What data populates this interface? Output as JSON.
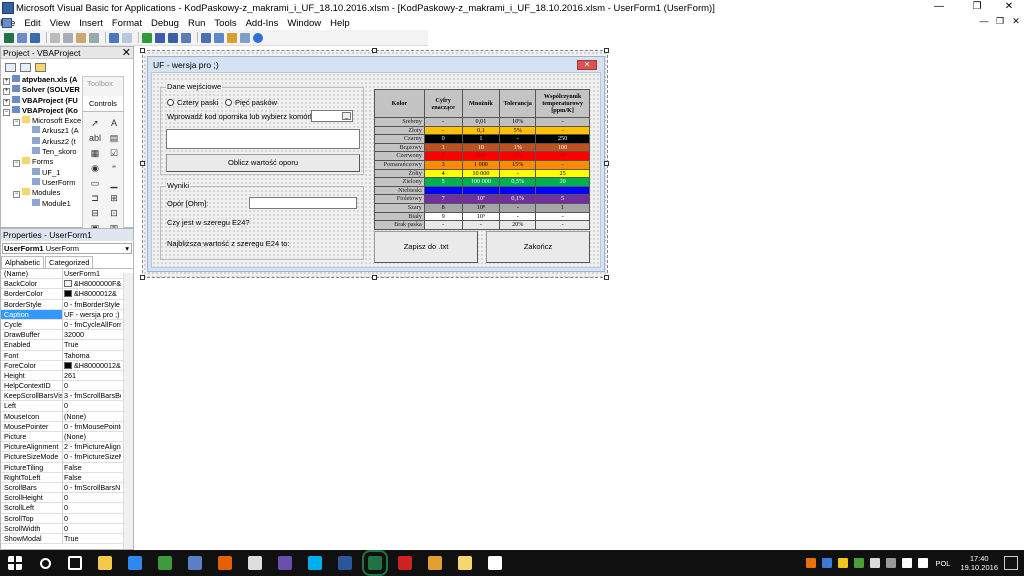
{
  "window": {
    "title": "Microsoft Visual Basic for Applications - KodPaskowy-z_makrami_i_UF_18.10.2016.xlsm - [KodPaskowy-z_makrami_i_UF_18.10.2016.xlsm - UserForm1 (UserForm)]",
    "controls": [
      "—",
      "❐",
      "✕"
    ]
  },
  "menu": {
    "items": [
      "File",
      "Edit",
      "View",
      "Insert",
      "Format",
      "Debug",
      "Run",
      "Tools",
      "Add-Ins",
      "Window",
      "Help"
    ],
    "doc_controls": [
      "—",
      "❐",
      "✕"
    ]
  },
  "project": {
    "title": "Project - VBAProject",
    "tree": [
      {
        "indent": 0,
        "text": "atpvbaen.xls (A",
        "bold": true,
        "sign": "+"
      },
      {
        "indent": 0,
        "text": "Solver (SOLVER",
        "bold": true,
        "sign": "+"
      },
      {
        "indent": 0,
        "text": "VBAProject (FU",
        "bold": true,
        "sign": "+"
      },
      {
        "indent": 0,
        "text": "VBAProject (Ko",
        "bold": true,
        "sign": "−"
      },
      {
        "indent": 1,
        "text": "Microsoft Exce",
        "bold": false,
        "sign": "−"
      },
      {
        "indent": 2,
        "text": "Arkusz1 (A",
        "bold": false,
        "sign": ""
      },
      {
        "indent": 2,
        "text": "Arkusz2 (t",
        "bold": false,
        "sign": ""
      },
      {
        "indent": 2,
        "text": "Ten_skoro",
        "bold": false,
        "sign": ""
      },
      {
        "indent": 1,
        "text": "Forms",
        "bold": false,
        "sign": "−"
      },
      {
        "indent": 2,
        "text": "UF_1",
        "bold": false,
        "sign": ""
      },
      {
        "indent": 2,
        "text": "UserForm",
        "bold": false,
        "sign": ""
      },
      {
        "indent": 1,
        "text": "Modules",
        "bold": false,
        "sign": "−"
      },
      {
        "indent": 2,
        "text": "Module1",
        "bold": false,
        "sign": ""
      }
    ]
  },
  "toolbox": {
    "title": "Toolbox",
    "tab": "Controls",
    "tools": [
      "➚",
      "A",
      "abl",
      "▤",
      "▦",
      "☑",
      "◉",
      "⁼",
      "▭",
      "▁",
      "⊐",
      "⊞",
      "⊟",
      "⊡",
      "▣",
      "▥"
    ]
  },
  "properties": {
    "title": "Properties - UserForm1",
    "object_name": "UserForm1",
    "object_type": "UserForm",
    "tabs": [
      "Alphabetic",
      "Categorized"
    ],
    "rows": [
      {
        "name": "(Name)",
        "value": "UserForm1"
      },
      {
        "name": "BackColor",
        "value": "&H8000000F&",
        "swatch": "#f0f0f0"
      },
      {
        "name": "BorderColor",
        "value": "&H8000012&",
        "swatch": "#000000"
      },
      {
        "name": "BorderStyle",
        "value": "0 - fmBorderStyle"
      },
      {
        "name": "Caption",
        "value": "UF - wersja pro ;)",
        "selected": true
      },
      {
        "name": "Cycle",
        "value": "0 - fmCycleAllForm"
      },
      {
        "name": "DrawBuffer",
        "value": "32000"
      },
      {
        "name": "Enabled",
        "value": "True"
      },
      {
        "name": "Font",
        "value": "Tahoma"
      },
      {
        "name": "ForeColor",
        "value": "&H80000012&",
        "swatch": "#000000"
      },
      {
        "name": "Height",
        "value": "261"
      },
      {
        "name": "HelpContextID",
        "value": "0"
      },
      {
        "name": "KeepScrollBarsVisib",
        "value": "3 - fmScrollBarsBo"
      },
      {
        "name": "Left",
        "value": "0"
      },
      {
        "name": "MouseIcon",
        "value": "(None)"
      },
      {
        "name": "MousePointer",
        "value": "0 - fmMousePointe"
      },
      {
        "name": "Picture",
        "value": "(None)"
      },
      {
        "name": "PictureAlignment",
        "value": "2 - fmPictureAlign"
      },
      {
        "name": "PictureSizeMode",
        "value": "0 - fmPictureSizeM"
      },
      {
        "name": "PictureTiling",
        "value": "False"
      },
      {
        "name": "RightToLeft",
        "value": "False"
      },
      {
        "name": "ScrollBars",
        "value": "0 - fmScrollBarsN"
      },
      {
        "name": "ScrollHeight",
        "value": "0"
      },
      {
        "name": "ScrollLeft",
        "value": "0"
      },
      {
        "name": "ScrollTop",
        "value": "0"
      },
      {
        "name": "ScrollWidth",
        "value": "0"
      },
      {
        "name": "ShowModal",
        "value": "True"
      }
    ]
  },
  "userform": {
    "caption": "UF - wersja pro ;)",
    "close": "✕",
    "input_frame": {
      "label": "Dane wejściowe",
      "radio1": "Cztery paski",
      "radio2": "Pięć pasków",
      "prompt": "Wprowadź kod opornika lub wybierz komórkę",
      "calc_button": "Oblicz wartość oporu"
    },
    "results_frame": {
      "label": "Wyniki",
      "resistance": "Opór [Ohm]:",
      "e24_question": "Czy jest w szeregu E24?",
      "nearest": "Najbliższa wartość z szeregu E24 to:"
    },
    "save_button": "Zapisz do .txt",
    "exit_button": "Zakończ",
    "color_table": {
      "headers": [
        "Kolor",
        "Cyfry znaczące",
        "Mnożnik",
        "Tolerancja",
        "Współczynnik temperaturowy [ppm/K]"
      ],
      "rows": [
        {
          "name": "Srebrny",
          "bg": "#c0c0c0",
          "fg": "#000",
          "cells": [
            "-",
            "0,01",
            "10%",
            "-"
          ]
        },
        {
          "name": "Złoty",
          "bg": "#ffc000",
          "fg": "#000",
          "cells": [
            "-",
            "0,1",
            "5%",
            "-"
          ]
        },
        {
          "name": "Czarny",
          "bg": "#000000",
          "fg": "#fff",
          "cells": [
            "0",
            "1",
            "-",
            "250"
          ]
        },
        {
          "name": "Brązowy",
          "bg": "#c0501e",
          "fg": "#fff",
          "cells": [
            "1",
            "10",
            "1%",
            "100"
          ]
        },
        {
          "name": "Czerwony",
          "bg": "#ff0000",
          "fg": "#c00000",
          "cells": [
            "2",
            "100",
            "2%",
            "50"
          ]
        },
        {
          "name": "Pomarańczowy",
          "bg": "#ff8c00",
          "fg": "#000",
          "cells": [
            "3",
            "1 000",
            "15%",
            "-"
          ]
        },
        {
          "name": "Żółty",
          "bg": "#ffff00",
          "fg": "#000",
          "cells": [
            "4",
            "10 000",
            "-",
            "25"
          ]
        },
        {
          "name": "Zielony",
          "bg": "#00b050",
          "fg": "#fff",
          "cells": [
            "5",
            "100 000",
            "0,5%",
            "20"
          ]
        },
        {
          "name": "Niebieski",
          "bg": "#0000ff",
          "fg": "#fff",
          "cells": [
            "",
            "",
            "",
            ""
          ]
        },
        {
          "name": "Fioletowy",
          "bg": "#7030a0",
          "fg": "#fff",
          "cells": [
            "7",
            "10⁷",
            "0,1%",
            "5"
          ]
        },
        {
          "name": "Szary",
          "bg": "#a6a6a6",
          "fg": "#000",
          "cells": [
            "8",
            "10⁸",
            "-",
            "1"
          ]
        },
        {
          "name": "Biały",
          "bg": "#ffffff",
          "fg": "#000",
          "cells": [
            "9",
            "10⁹",
            "-",
            "-"
          ]
        },
        {
          "name": "Brak paska",
          "bg": "#e8e8e8",
          "fg": "#000",
          "cells": [
            "-",
            "-",
            "20%",
            "-"
          ]
        }
      ]
    }
  },
  "taskbar": {
    "icons": [
      {
        "name": "start-icon",
        "color": "#ffffff"
      },
      {
        "name": "search-icon",
        "color": "#ffffff"
      },
      {
        "name": "task-view-icon",
        "color": "#ffffff"
      },
      {
        "name": "file-explorer-icon",
        "color": "#f2c94c"
      },
      {
        "name": "store-icon",
        "color": "#2d89ef"
      },
      {
        "name": "app-green-icon",
        "color": "#3c9a3c"
      },
      {
        "name": "app-blue-doc-icon",
        "color": "#5b7fc7"
      },
      {
        "name": "firefox-icon",
        "color": "#e66000"
      },
      {
        "name": "calculator-icon",
        "color": "#dddddd"
      },
      {
        "name": "app-badge-icon",
        "color": "#6a4fb0"
      },
      {
        "name": "skype-icon",
        "color": "#00aff0"
      },
      {
        "name": "word-icon",
        "color": "#2b579a"
      },
      {
        "name": "excel-icon",
        "color": "#217346"
      },
      {
        "name": "app-red-icon",
        "color": "#cc2222"
      },
      {
        "name": "app-wing-icon",
        "color": "#e0a030"
      },
      {
        "name": "app-folder-icon",
        "color": "#f5d76e"
      },
      {
        "name": "app-circle-icon",
        "color": "#ffffff"
      }
    ],
    "tray_icons": [
      "#e8710a",
      "#3a7bd5",
      "#f0c419",
      "#4c9f38",
      "#d9d9d9",
      "#999999",
      "#ffffff",
      "#ffffff"
    ],
    "language": "POL",
    "time": "17:40",
    "date": "19.10.2016"
  }
}
